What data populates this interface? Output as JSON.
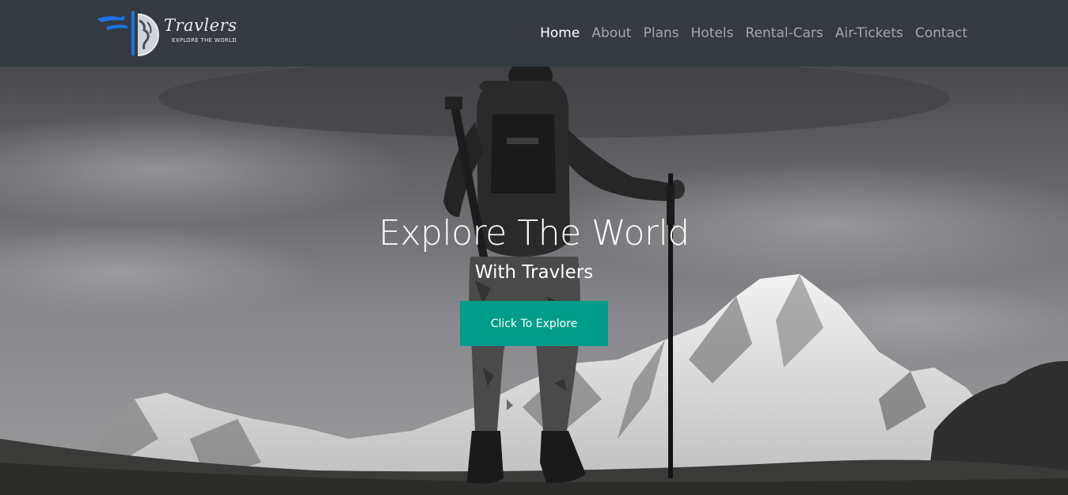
{
  "brand": {
    "name": "Travlers",
    "tagline": "EXPLORE THE WORLD",
    "logo_icon": "globe-compass-logo",
    "accent_color": "#1a73e8"
  },
  "nav": {
    "items": [
      {
        "label": "Home",
        "active": true
      },
      {
        "label": "About",
        "active": false
      },
      {
        "label": "Plans",
        "active": false
      },
      {
        "label": "Hotels",
        "active": false
      },
      {
        "label": "Rental-Cars",
        "active": false
      },
      {
        "label": "Air-Tickets",
        "active": false
      },
      {
        "label": "Contact",
        "active": false
      }
    ],
    "background": "#343a40"
  },
  "hero": {
    "title": "Explore The World",
    "subtitle": "With Travlers",
    "button_label": "Click To Explore",
    "button_color": "#009e8a",
    "background_image": "black-and-white photo of a hiker with backpack and trekking pole facing snowy mountains"
  }
}
